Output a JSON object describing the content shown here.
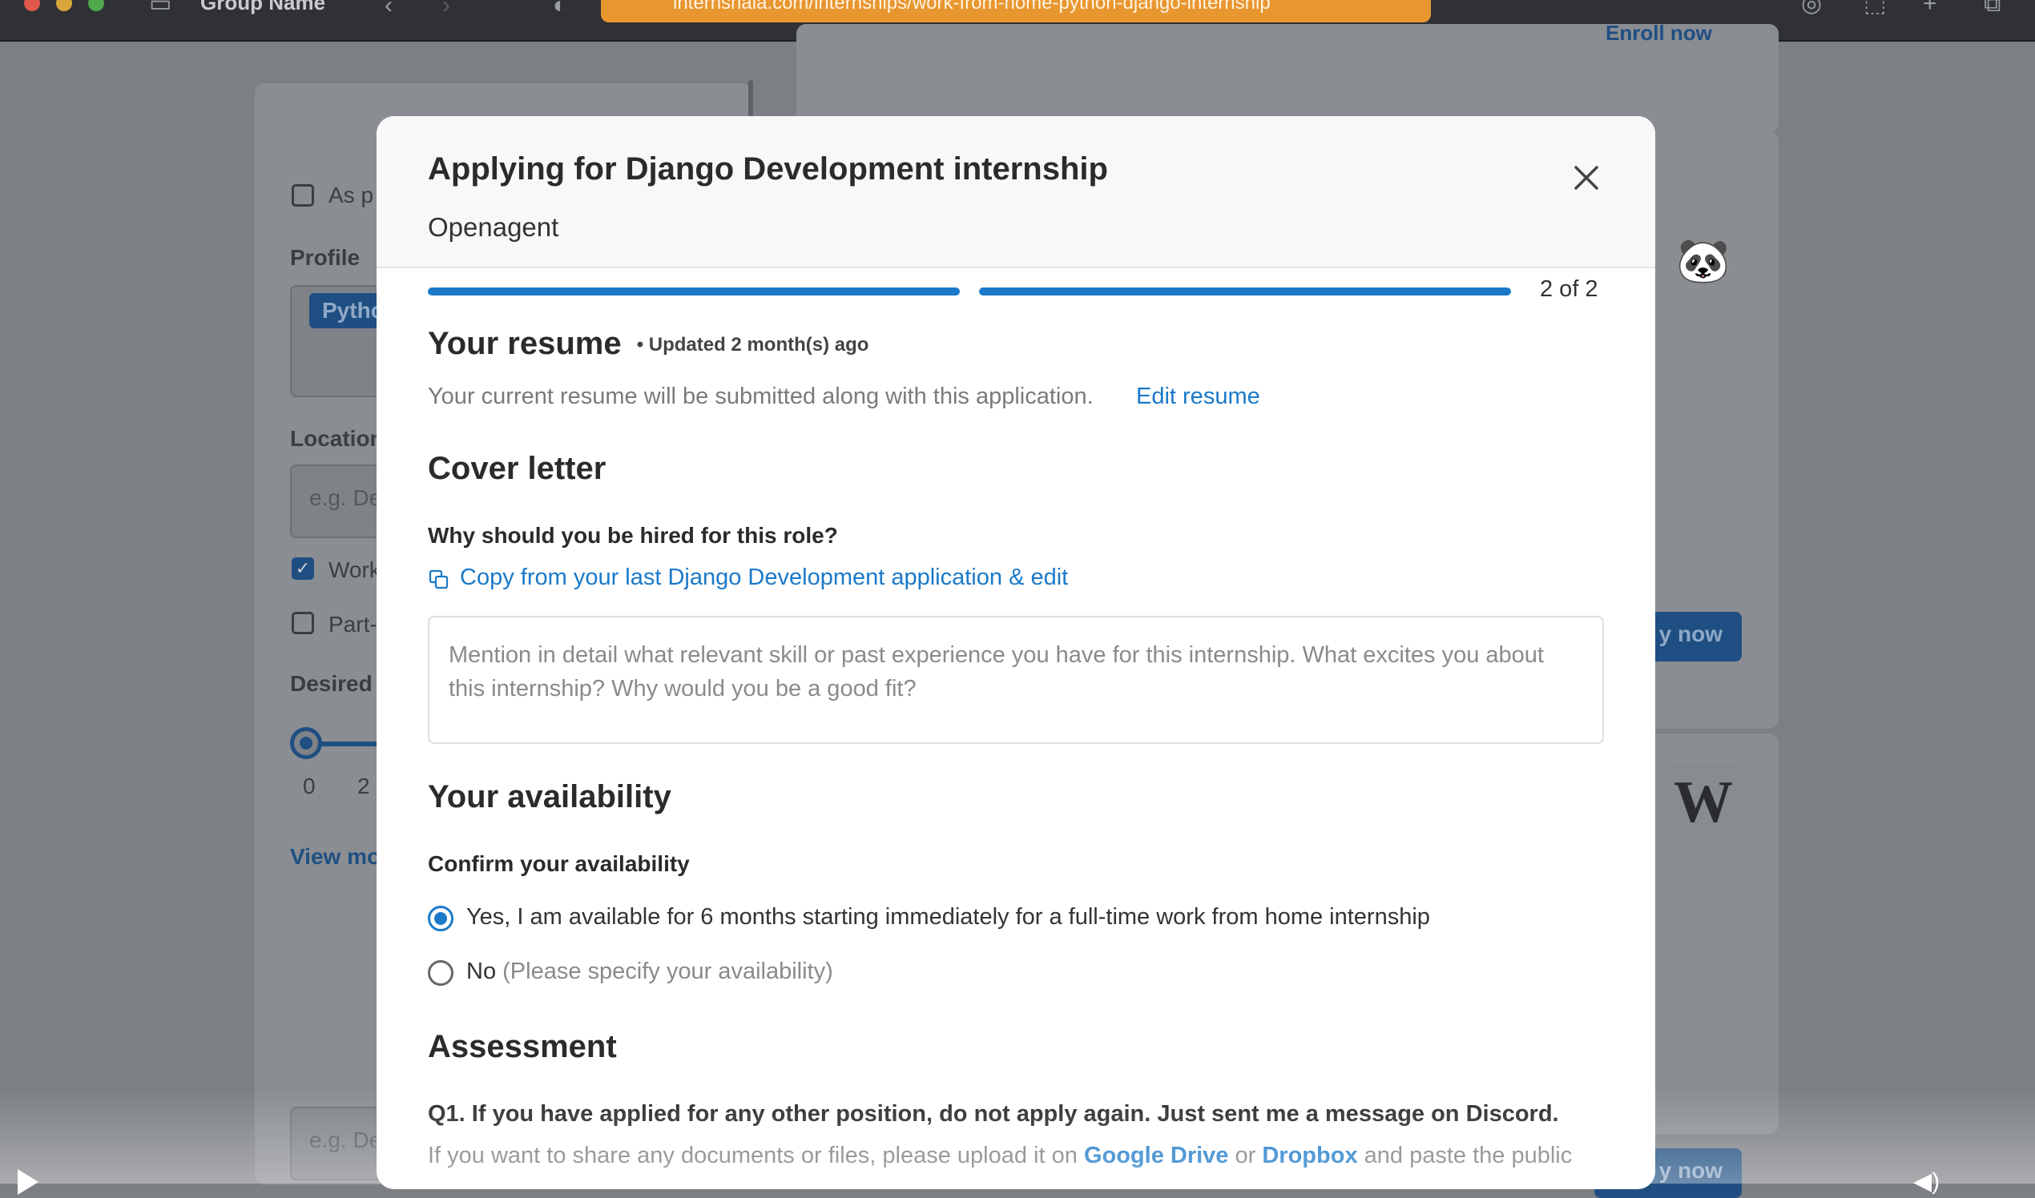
{
  "browser": {
    "group_name": "Group Name",
    "url": "internshala.com/internships/work-from-home-python-django-internship"
  },
  "background": {
    "top_link": "Enroll now",
    "checkbox_as_per": "As p",
    "profile_label": "Profile",
    "profile_chip": "Pytho",
    "location_label": "Location",
    "location_placeholder": "e.g. De",
    "work_from_home": "Work",
    "part_time": "Part-",
    "desired_label": "Desired",
    "slider_min": "0",
    "slider_next": "2",
    "view_more": "View mo",
    "apply_now_1": "y now",
    "bottom_placeholder": "e.g. De",
    "apply_now_2": "y now"
  },
  "modal": {
    "title": "Applying for Django Development internship",
    "company": "Openagent",
    "progress": {
      "step": 2,
      "total": 2,
      "text": "2 of 2"
    },
    "resume": {
      "heading": "Your resume",
      "updated": "• Updated 2 month(s) ago",
      "note": "Your current resume will be submitted along with this application.",
      "edit_link": "Edit resume"
    },
    "cover_letter": {
      "heading": "Cover letter",
      "question": "Why should you be hired for this role?",
      "copy_link": "Copy from your last Django Development application & edit",
      "placeholder": "Mention in detail what relevant skill or past experience you have for this internship. What excites you about this internship? Why would you be a good fit?"
    },
    "availability": {
      "heading": "Your availability",
      "label": "Confirm your availability",
      "options": [
        {
          "label": "Yes, I am available for 6 months starting immediately for a full-time work from home internship",
          "hint": "",
          "selected": true
        },
        {
          "label": "No",
          "hint": "(Please specify your availability)",
          "selected": false
        }
      ]
    },
    "assessment": {
      "heading": "Assessment",
      "q1": "Q1. If you have applied for any other position, do not apply again. Just sent me a message on Discord.",
      "q1_sub_prefix": "If you want to share any documents or files, please upload it on",
      "google_drive": "Google Drive",
      "or": "or",
      "dropbox": "Dropbox",
      "q1_sub_suffix": "and paste the public"
    }
  },
  "colors": {
    "accent": "#1b79c9",
    "url_bar": "#e8962f",
    "overlay": "#7c7f83"
  }
}
